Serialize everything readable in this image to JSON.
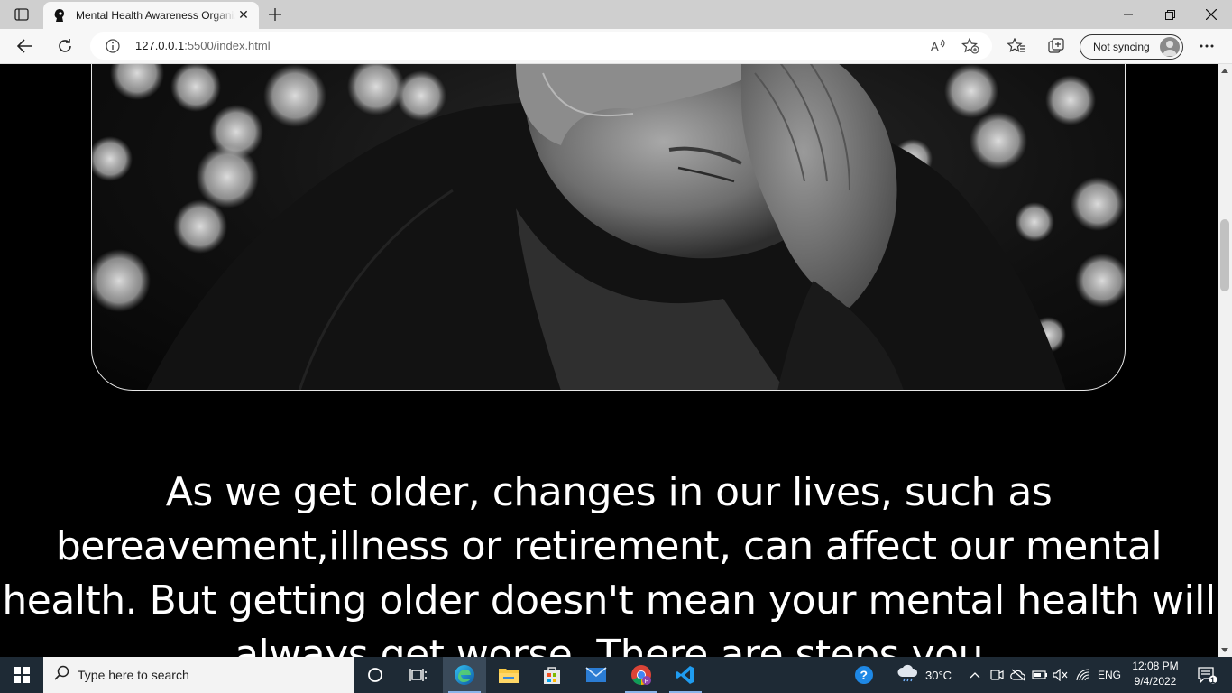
{
  "browser": {
    "tab_title": "Mental Health Awareness Organization",
    "new_tab_symbol": "+",
    "tab_close_symbol": "✕",
    "url_host": "127.0.0.1",
    "url_rest": ":5500/index.html",
    "profile_label": "Not syncing",
    "icons": [
      "tab-actions-icon",
      "favicon-icon",
      "back-icon",
      "refresh-icon",
      "info-icon",
      "read-aloud-icon",
      "add-favorite-icon",
      "favorites-icon",
      "collections-icon",
      "more-icon",
      "minimize-icon",
      "restore-icon",
      "close-icon"
    ]
  },
  "page": {
    "hero_image_alt": "Elderly man resting his head in his hand",
    "quote": "As we get older, changes in our lives, such as bereavement,illness or retirement, can affect our mental health. But getting older doesn't mean your mental health will always get worse. There are steps you"
  },
  "taskbar": {
    "search_placeholder": "Type here to search",
    "weather": "30°C",
    "language": "ENG",
    "time": "12:08 PM",
    "date": "9/4/2022",
    "notification_count": "1",
    "apps": [
      "cortana-icon",
      "task-view-icon",
      "edge-icon",
      "file-explorer-icon",
      "microsoft-store-icon",
      "mail-icon",
      "chrome-icon",
      "vscode-icon"
    ]
  }
}
